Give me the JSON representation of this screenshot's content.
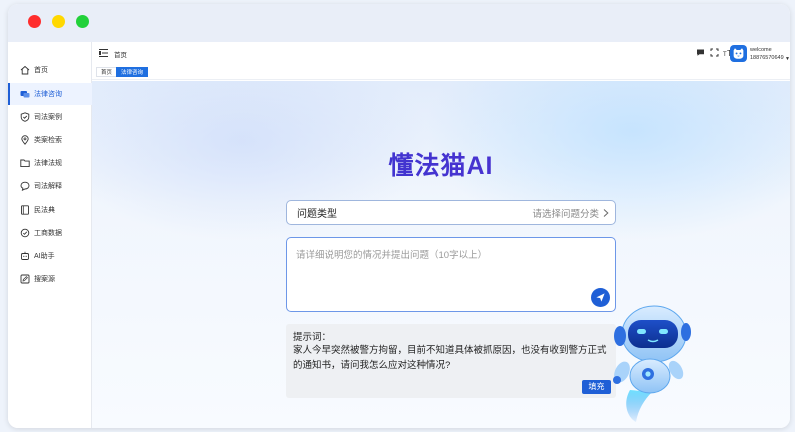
{
  "window": {
    "traffic_lights": [
      "close",
      "minimize",
      "maximize"
    ]
  },
  "sidebar": {
    "items": [
      {
        "label": "首页",
        "icon": "home-icon",
        "active": false
      },
      {
        "label": "法律咨询",
        "icon": "chat-bubbles-icon",
        "active": true
      },
      {
        "label": "司法案例",
        "icon": "shield-icon",
        "active": false
      },
      {
        "label": "类案检索",
        "icon": "location-pin-icon",
        "active": false
      },
      {
        "label": "法律法规",
        "icon": "folder-icon",
        "active": false
      },
      {
        "label": "司法解释",
        "icon": "chat-icon",
        "active": false
      },
      {
        "label": "民法典",
        "icon": "book-icon",
        "active": false
      },
      {
        "label": "工商数据",
        "icon": "badge-icon",
        "active": false
      },
      {
        "label": "AI助手",
        "icon": "robot-icon",
        "active": false
      },
      {
        "label": "搜案源",
        "icon": "edit-icon",
        "active": false
      }
    ]
  },
  "header": {
    "breadcrumb": "首页",
    "user": {
      "greeting": "welcome",
      "phone": "18876570649"
    }
  },
  "tabs": [
    {
      "label": "首页",
      "active": false
    },
    {
      "label": "法律咨询",
      "active": true
    }
  ],
  "main": {
    "brand": "懂法猫AI",
    "question_type": {
      "label": "问题类型",
      "placeholder": "请选择问题分类"
    },
    "question_input": {
      "placeholder": "请详细说明您的情况并提出问题（10字以上）"
    },
    "hint": {
      "title": "提示词：",
      "text": "家人今早突然被警方拘留，目前不知道具体被抓原因，也没有收到警方正式的通知书，请问我怎么应对这种情况?",
      "fill_label": "填充"
    }
  },
  "colors": {
    "accent": "#1f5fd6",
    "brand_start": "#2f3bd0",
    "brand_end": "#5a2cd0"
  }
}
